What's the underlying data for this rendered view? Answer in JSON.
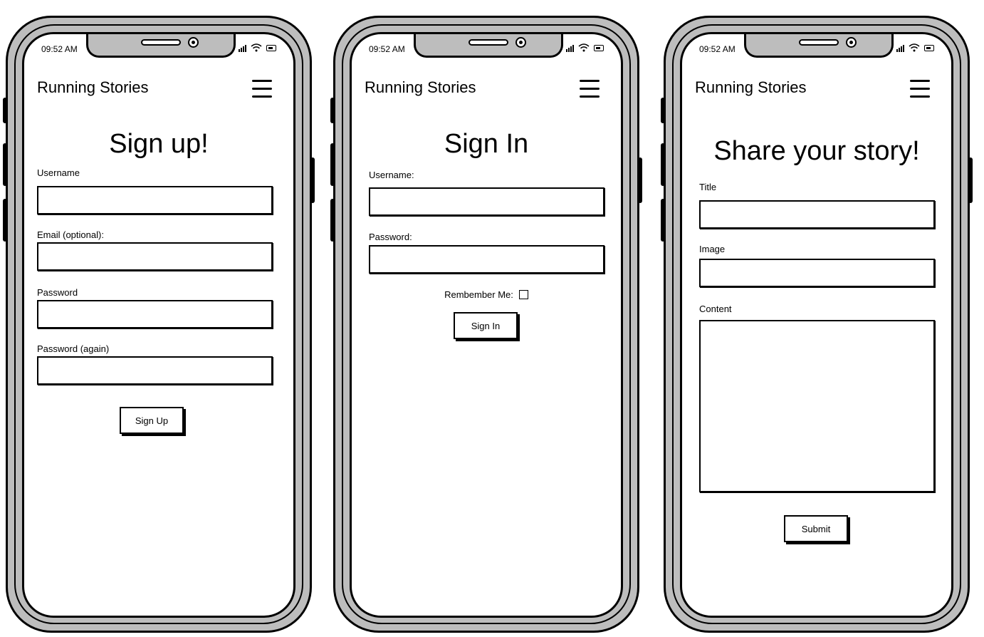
{
  "phones": [
    {
      "status": {
        "time": "09:52 AM"
      },
      "header": {
        "brand": "Running Stories"
      },
      "title": "Sign up!",
      "fields": [
        {
          "label": "Username"
        },
        {
          "label": "Email (optional):"
        },
        {
          "label": "Password"
        },
        {
          "label": "Password (again)"
        }
      ],
      "button": "Sign Up"
    },
    {
      "status": {
        "time": "09:52 AM"
      },
      "header": {
        "brand": "Running Stories"
      },
      "title": "Sign In",
      "fields": [
        {
          "label": "Username:"
        },
        {
          "label": "Password:"
        }
      ],
      "remember_label": "Rembember Me:",
      "button": "Sign In"
    },
    {
      "status": {
        "time": "09:52 AM"
      },
      "header": {
        "brand": "Running Stories"
      },
      "title": "Share your story!",
      "fields": [
        {
          "label": "Title"
        },
        {
          "label": "Image"
        },
        {
          "label": "Content"
        }
      ],
      "button": "Submit"
    }
  ]
}
